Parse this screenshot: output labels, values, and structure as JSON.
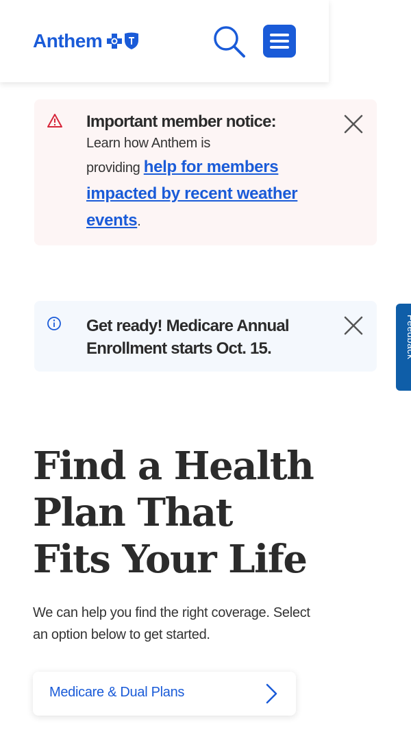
{
  "header": {
    "logo_text": "Anthem",
    "logo_marks": [
      "blue-cross-icon",
      "blue-shield-icon"
    ],
    "search_icon": "search-icon",
    "menu_icon": "hamburger-menu-icon"
  },
  "alerts": {
    "warning": {
      "icon": "warning-triangle-icon",
      "title": "Important member notice:",
      "text_line1": "Learn how Anthem is",
      "text_line2_prefix": "providing ",
      "link_text": "help for members impacted by recent weather events",
      "suffix": ".",
      "close_icon": "close-icon"
    },
    "info": {
      "icon": "info-circle-icon",
      "title": "Get ready! Medicare Annual Enrollment starts Oct. 15.",
      "close_icon": "close-icon"
    }
  },
  "feedback": {
    "label": "Feedback"
  },
  "hero": {
    "title": "Find a Health Plan That Fits Your Life",
    "subtitle": "We can help you find the right coverage. Select an option below to get started."
  },
  "plans": [
    {
      "label": "Medicare & Dual Plans",
      "icon": "chevron-right-icon"
    }
  ],
  "colors": {
    "brand_blue": "#1a5bd8",
    "warning_red": "#d6263a",
    "warning_bg": "#fdf5f5",
    "info_bg": "#f4f8fd",
    "feedback_blue": "#0f5ea8"
  }
}
